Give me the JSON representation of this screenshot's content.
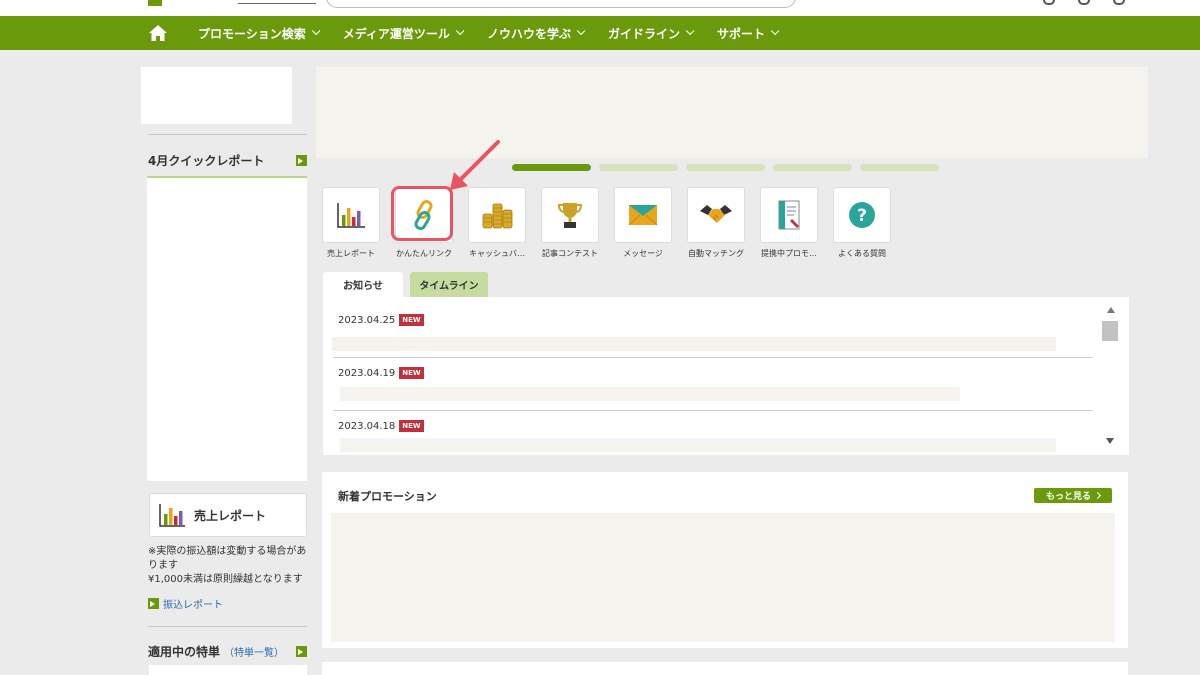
{
  "nav": {
    "items": [
      {
        "label": "プロモーション検索"
      },
      {
        "label": "メディア運営ツール"
      },
      {
        "label": "ノウハウを学ぶ"
      },
      {
        "label": "ガイドライン"
      },
      {
        "label": "サポート"
      }
    ]
  },
  "sidebar": {
    "quick_report_title": "4月クイックレポート",
    "sales_card_label": "売上レポート",
    "note": "※実際の振込額は変動する場合があります\n¥1,000未満は原則繰越となります",
    "transfer_link": "振込レポート",
    "tokuten_title": "適用中の特単",
    "tokuten_link": "（特単一覧）"
  },
  "quick_icons": [
    {
      "label": "売上レポート",
      "icon": "bar-chart-icon"
    },
    {
      "label": "かんたんリンク",
      "icon": "link-icon"
    },
    {
      "label": "キャッシュバ…",
      "icon": "coins-icon"
    },
    {
      "label": "記事コンテスト",
      "icon": "trophy-icon"
    },
    {
      "label": "メッセージ",
      "icon": "mail-icon"
    },
    {
      "label": "自動マッチング",
      "icon": "handshake-icon"
    },
    {
      "label": "提携中プロモ…",
      "icon": "document-icon"
    },
    {
      "label": "よくある質問",
      "icon": "question-icon"
    }
  ],
  "tabs": {
    "notice": "お知らせ",
    "timeline": "タイムライン"
  },
  "news": [
    {
      "date": "2023.04.25",
      "badge": "NEW"
    },
    {
      "date": "2023.04.19",
      "badge": "NEW"
    },
    {
      "date": "2023.04.18",
      "badge": "NEW"
    }
  ],
  "promotions": {
    "title": "新着プロモーション",
    "more": "もっと見る"
  },
  "colors": {
    "brand_green": "#6a9a0c",
    "highlight_red": "#e8545f",
    "badge_red": "#c0303d"
  }
}
